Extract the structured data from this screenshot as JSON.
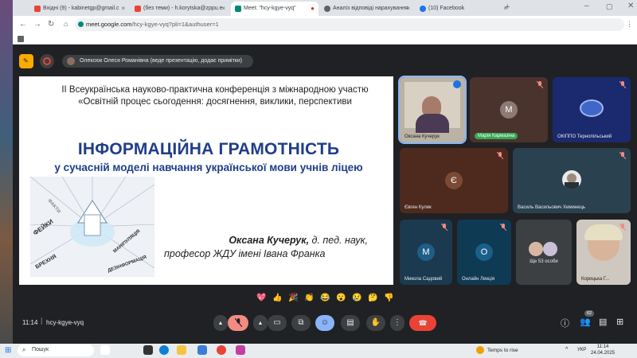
{
  "browser": {
    "tabs": [
      {
        "label": "Вхідні (9) - kabinetgp@gmail.c",
        "active": false
      },
      {
        "label": "(без теми) - h.korytska@zppu.e",
        "active": false
      },
      {
        "label": "Meet: \"hcy-kgye-vyq\"",
        "active": true
      },
      {
        "label": "Аналіз відповіді нарахування",
        "active": false
      },
      {
        "label": "(10) Facebook",
        "active": false
      }
    ],
    "url_host": "meet.google.com",
    "url_path": "/hcy-kgye-vyq?pli=1&authuser=1"
  },
  "meet": {
    "presenter_label": "Олексюк Олеся Романівна (веде презентацію, додає примітки)",
    "slide": {
      "subtitle": "ІІ Всеукраїнська науково-практична конференція з міжнародною участю «Освітній процес сьогодення: досягнення, виклики, перспективи",
      "title": "ІНФОРМАЦІЙНА ГРАМОТНІСТЬ",
      "title2": "у сучасній моделі навчання української мови учнів ліцею",
      "author_name": "Оксана Кучерук,",
      "author_rest": "д. пед. наук,",
      "author_line2": "професор ЖДУ імені Івана Франка",
      "art_words": [
        "ФЕЙКИ",
        "БРЕХНЯ",
        "МАНІПУЛЯЦІЯ",
        "ДЕЗІНФОРМАЦІЯ",
        "ФАКТИ"
      ]
    },
    "tiles": [
      {
        "name": "Оксана Кучерук",
        "initial": "",
        "speaking": true
      },
      {
        "name": "Марія Кармазіна",
        "initial": "М",
        "speaking": false
      },
      {
        "name": "ОКІППО Тернопільський",
        "initial": "",
        "speaking": false
      },
      {
        "name": "Євген Кулик",
        "initial": "Є",
        "speaking": false
      },
      {
        "name": "Василь Васильович Химинець",
        "initial": "",
        "speaking": false
      },
      {
        "name": "Микола Садовий",
        "initial": "М",
        "speaking": false
      },
      {
        "name": "Онлайн Лекція",
        "initial": "О",
        "speaking": false
      },
      {
        "name": "Ще 53 особи",
        "initial": "",
        "speaking": false
      },
      {
        "name": "Корицька Г...",
        "initial": "",
        "speaking": false
      }
    ],
    "reactions": [
      "💖",
      "👍",
      "🎉",
      "👏",
      "😂",
      "😮",
      "😢",
      "🤔",
      "👎"
    ],
    "time": "11:14",
    "meeting_code": "hcy-kgye-vyq",
    "participants_count": "62"
  },
  "taskbar": {
    "search_label": "Пошук",
    "weather": "Temps to rise",
    "lang": "УКР",
    "time": "11:14",
    "date": "24.04.2025"
  },
  "colors": {
    "meet_bg": "#202124",
    "slide_title": "#1f3d8a",
    "end_call": "#ea4335",
    "mic_off": "#f28b82",
    "active_speaker": "#8ab4f8"
  }
}
